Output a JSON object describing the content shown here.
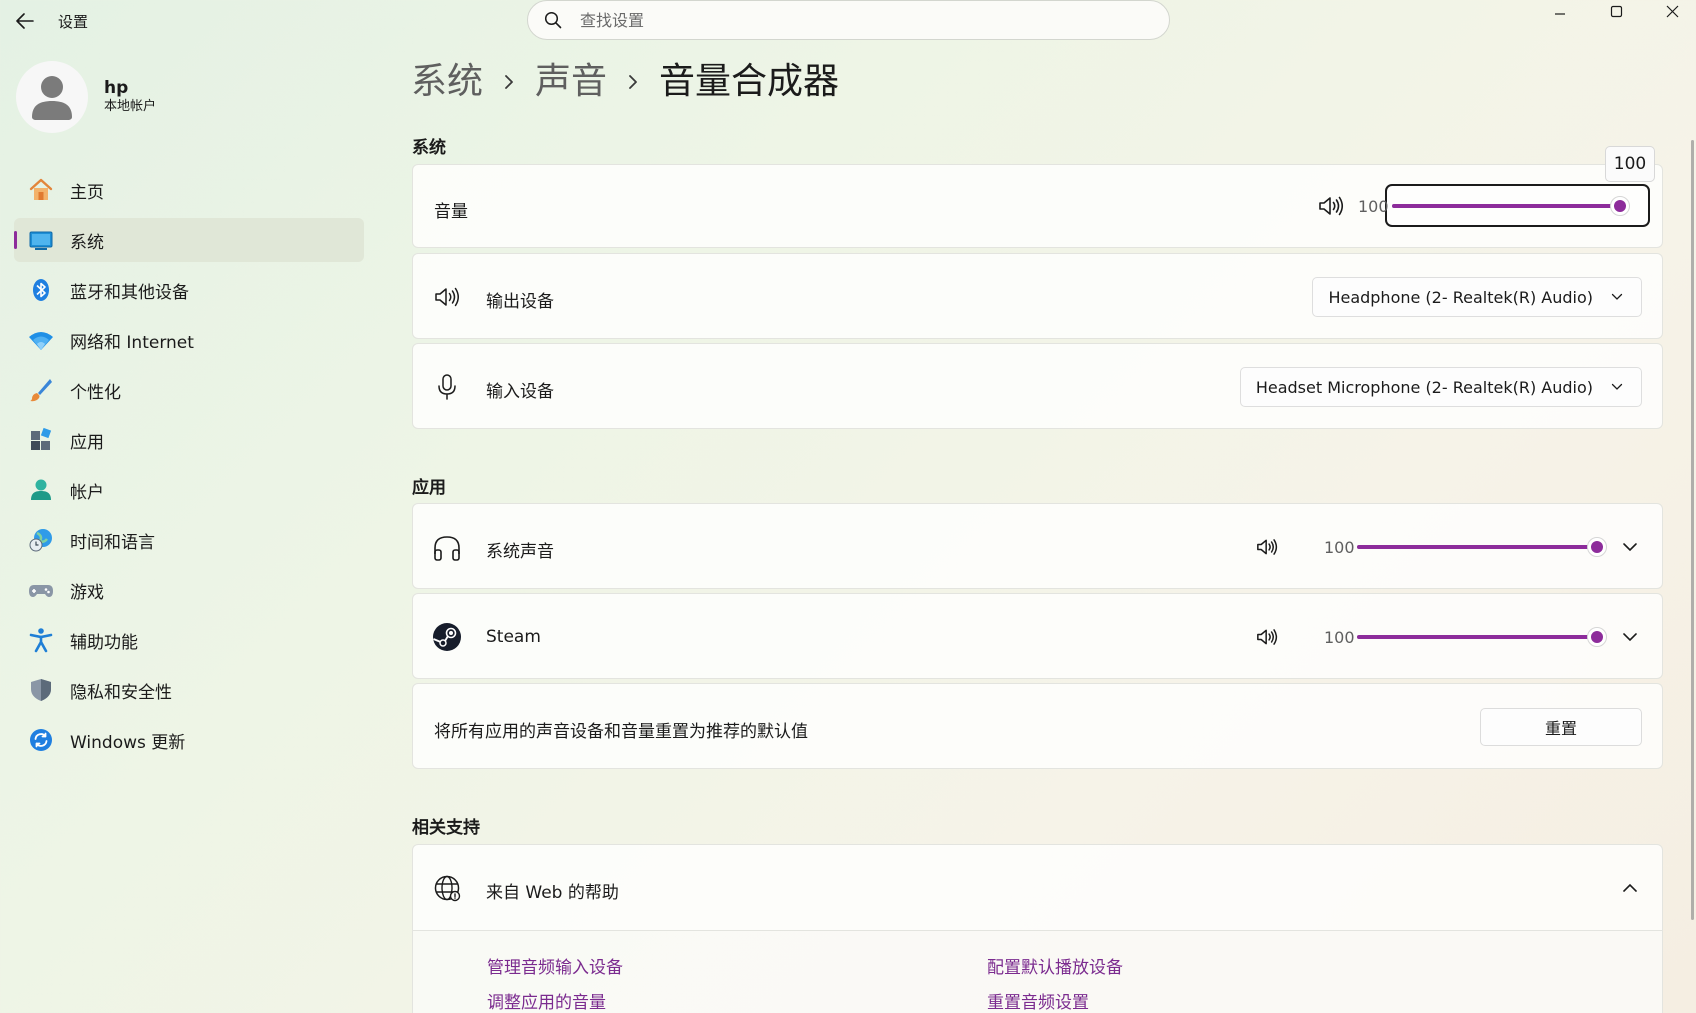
{
  "window": {
    "title": "设置",
    "minimize_label": "Minimize",
    "maximize_label": "Maximize",
    "close_label": "Close"
  },
  "search": {
    "placeholder": "查找设置"
  },
  "profile": {
    "name": "hp",
    "subtitle": "本地帐户"
  },
  "sidebar": {
    "items": [
      {
        "label": "主页",
        "icon": "home-icon"
      },
      {
        "label": "系统",
        "icon": "system-icon",
        "active": true
      },
      {
        "label": "蓝牙和其他设备",
        "icon": "bluetooth-icon"
      },
      {
        "label": "网络和 Internet",
        "icon": "wifi-icon"
      },
      {
        "label": "个性化",
        "icon": "brush-icon"
      },
      {
        "label": "应用",
        "icon": "apps-icon"
      },
      {
        "label": "帐户",
        "icon": "account-icon"
      },
      {
        "label": "时间和语言",
        "icon": "time-language-icon"
      },
      {
        "label": "游戏",
        "icon": "gamepad-icon"
      },
      {
        "label": "辅助功能",
        "icon": "accessibility-icon"
      },
      {
        "label": "隐私和安全性",
        "icon": "shield-icon"
      },
      {
        "label": "Windows 更新",
        "icon": "windows-update-icon"
      }
    ]
  },
  "breadcrumb": {
    "level1": "系统",
    "level2": "声音",
    "current": "音量合成器"
  },
  "system_section": {
    "label": "系统",
    "volume": {
      "label": "音量",
      "value": 100,
      "display": "100",
      "tooltip": "100"
    },
    "output": {
      "label": "输出设备",
      "selected": "Headphone (2- Realtek(R) Audio)"
    },
    "input": {
      "label": "输入设备",
      "selected": "Headset Microphone (2- Realtek(R) Audio)"
    }
  },
  "apps_section": {
    "label": "应用",
    "apps": [
      {
        "label": "系统声音",
        "icon": "headphones-icon",
        "value": 100,
        "display": "100"
      },
      {
        "label": "Steam",
        "icon": "steam-icon",
        "value": 100,
        "display": "100"
      }
    ],
    "reset": {
      "label": "将所有应用的声音设备和音量重置为推荐的默认值",
      "button": "重置"
    }
  },
  "support_section": {
    "label": "相关支持",
    "help": {
      "label": "来自 Web 的帮助"
    },
    "links": [
      "管理音频输入设备",
      "配置默认播放设备",
      "调整应用的音量",
      "重置音频设置"
    ]
  },
  "colors": {
    "accent": "#8d2c9b",
    "link": "#7b2b8f"
  }
}
